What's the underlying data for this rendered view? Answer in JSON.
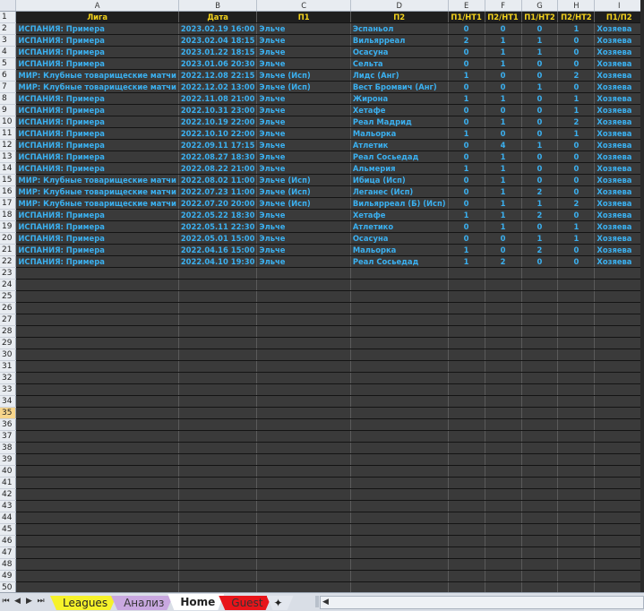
{
  "columns": [
    "A",
    "B",
    "C",
    "D",
    "E",
    "F",
    "G",
    "H",
    "I"
  ],
  "header": [
    "Лига",
    "Дата",
    "П1",
    "П2",
    "П1/НТ1",
    "П2/НТ1",
    "П1/НТ2",
    "П2/НТ2",
    "П1/П2"
  ],
  "rows": [
    [
      "ИСПАНИЯ: Примера",
      "2023.02.19 16:00",
      "Эльче",
      "Эспаньол",
      "0",
      "0",
      "0",
      "1",
      "Хозяева"
    ],
    [
      "ИСПАНИЯ: Примера",
      "2023.02.04 18:15",
      "Эльче",
      "Вильярреал",
      "2",
      "1",
      "1",
      "0",
      "Хозяева"
    ],
    [
      "ИСПАНИЯ: Примера",
      "2023.01.22 18:15",
      "Эльче",
      "Осасуна",
      "0",
      "1",
      "1",
      "0",
      "Хозяева"
    ],
    [
      "ИСПАНИЯ: Примера",
      "2023.01.06 20:30",
      "Эльче",
      "Сельта",
      "0",
      "1",
      "0",
      "0",
      "Хозяева"
    ],
    [
      "МИР: Клубные товарищеские матчи",
      "2022.12.08 22:15",
      "Эльче (Исп)",
      "Лидс (Анг)",
      "1",
      "0",
      "0",
      "2",
      "Хозяева"
    ],
    [
      "МИР: Клубные товарищеские матчи",
      "2022.12.02 13:00",
      "Эльче (Исп)",
      "Вест Бромвич (Анг)",
      "0",
      "0",
      "1",
      "0",
      "Хозяева"
    ],
    [
      "ИСПАНИЯ: Примера",
      "2022.11.08 21:00",
      "Эльче",
      "Жирона",
      "1",
      "1",
      "0",
      "1",
      "Хозяева"
    ],
    [
      "ИСПАНИЯ: Примера",
      "2022.10.31 23:00",
      "Эльче",
      "Хетафе",
      "0",
      "0",
      "0",
      "1",
      "Хозяева"
    ],
    [
      "ИСПАНИЯ: Примера",
      "2022.10.19 22:00",
      "Эльче",
      "Реал Мадрид",
      "0",
      "1",
      "0",
      "2",
      "Хозяева"
    ],
    [
      "ИСПАНИЯ: Примера",
      "2022.10.10 22:00",
      "Эльче",
      "Мальорка",
      "1",
      "0",
      "0",
      "1",
      "Хозяева"
    ],
    [
      "ИСПАНИЯ: Примера",
      "2022.09.11 17:15",
      "Эльче",
      "Атлетик",
      "0",
      "4",
      "1",
      "0",
      "Хозяева"
    ],
    [
      "ИСПАНИЯ: Примера",
      "2022.08.27 18:30",
      "Эльче",
      "Реал Сосьедад",
      "0",
      "1",
      "0",
      "0",
      "Хозяева"
    ],
    [
      "ИСПАНИЯ: Примера",
      "2022.08.22 21:00",
      "Эльче",
      "Альмерия",
      "1",
      "1",
      "0",
      "0",
      "Хозяева"
    ],
    [
      "МИР: Клубные товарищеские матчи",
      "2022.08.02 11:00",
      "Эльче (Исп)",
      "Ибица (Исп)",
      "0",
      "1",
      "0",
      "0",
      "Хозяева"
    ],
    [
      "МИР: Клубные товарищеские матчи",
      "2022.07.23 11:00",
      "Эльче (Исп)",
      "Леганес (Исп)",
      "0",
      "1",
      "2",
      "0",
      "Хозяева"
    ],
    [
      "МИР: Клубные товарищеские матчи",
      "2022.07.20 20:00",
      "Эльче (Исп)",
      "Вильярреал (Б) (Исп)",
      "0",
      "1",
      "1",
      "2",
      "Хозяева"
    ],
    [
      "ИСПАНИЯ: Примера",
      "2022.05.22 18:30",
      "Эльче",
      "Хетафе",
      "1",
      "1",
      "2",
      "0",
      "Хозяева"
    ],
    [
      "ИСПАНИЯ: Примера",
      "2022.05.11 22:30",
      "Эльче",
      "Атлетико",
      "0",
      "1",
      "0",
      "1",
      "Хозяева"
    ],
    [
      "ИСПАНИЯ: Примера",
      "2022.05.01 15:00",
      "Эльче",
      "Осасуна",
      "0",
      "0",
      "1",
      "1",
      "Хозяева"
    ],
    [
      "ИСПАНИЯ: Примера",
      "2022.04.16 15:00",
      "Эльче",
      "Мальорка",
      "1",
      "0",
      "2",
      "0",
      "Хозяева"
    ],
    [
      "ИСПАНИЯ: Примера",
      "2022.04.10 19:30",
      "Эльче",
      "Реал Сосьедад",
      "1",
      "2",
      "0",
      "0",
      "Хозяева"
    ]
  ],
  "row_numbers": [
    "1",
    "2",
    "3",
    "4",
    "5",
    "6",
    "7",
    "8",
    "9",
    "10",
    "11",
    "12",
    "13",
    "14",
    "15",
    "16",
    "17",
    "18",
    "19",
    "20",
    "21",
    "22",
    "23",
    "24",
    "25",
    "26",
    "27",
    "28",
    "29",
    "30",
    "31",
    "32",
    "33",
    "34",
    "35",
    "36",
    "37",
    "38",
    "39",
    "40",
    "41",
    "42",
    "43",
    "44",
    "45",
    "46",
    "47",
    "48",
    "49",
    "50"
  ],
  "selected_row": "35",
  "sheet_tabs": [
    "Leagues",
    "Анализ",
    "Home",
    "Guest"
  ],
  "active_tab": "Home",
  "colors": {
    "header_text": "#f3d21c",
    "cell_text": "#3ab0f0",
    "cell_bg": "#3a3a3a",
    "tab_leagues": "#f6f22a",
    "tab_analysis": "#c9a8e0",
    "tab_guest": "#e8141a"
  }
}
